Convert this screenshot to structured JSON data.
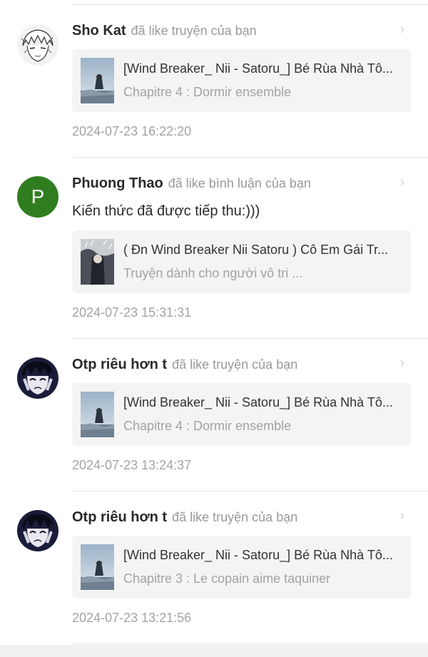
{
  "notifications": [
    {
      "user": "Sho Kat",
      "action": "đã like truyện của bạn",
      "avatar_icon": "sketch-face-avatar",
      "comment": "",
      "story_title": "[Wind Breaker_ Nii - Satoru_] Bé Rùa Nhà Tô...",
      "story_subtitle": "Chapitre 4 : Dormir ensemble",
      "timestamp": "2024-07-23 16:22:20"
    },
    {
      "user": "Phuong Thao",
      "action": "đã like bình luận của bạn",
      "avatar_letter": "P",
      "avatar_color": "#2f7d1f",
      "comment": "Kiến thức đã được tiếp thu:)))",
      "story_title": "( Đn Wind Breaker Nii Satoru ) Cô Em Gái Tr...",
      "story_subtitle": "Truyện dành cho người vô tri ...",
      "timestamp": "2024-07-23 15:31:31"
    },
    {
      "user": "Otp riêu hơn t",
      "action": "đã like truyện của bạn",
      "avatar_icon": "dark-anime-avatar",
      "comment": "",
      "story_title": "[Wind Breaker_ Nii - Satoru_] Bé Rùa Nhà Tô...",
      "story_subtitle": "Chapitre 4 : Dormir ensemble",
      "timestamp": "2024-07-23 13:24:37"
    },
    {
      "user": "Otp riêu hơn t",
      "action": "đã like truyện của bạn",
      "avatar_icon": "dark-anime-avatar",
      "comment": "",
      "story_title": "[Wind Breaker_ Nii - Satoru_] Bé Rùa Nhà Tô...",
      "story_subtitle": "Chapitre 3 : Le copain aime taquiner",
      "timestamp": "2024-07-23 13:21:56"
    }
  ],
  "chevron_icon": "chevron-right-icon"
}
